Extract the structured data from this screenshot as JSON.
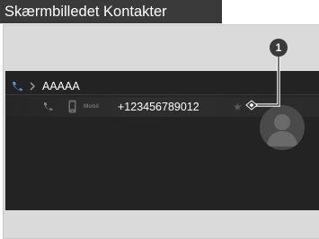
{
  "caption": {
    "title": "Skærmbilledet Kontakter"
  },
  "contact": {
    "name": "AAAAA"
  },
  "entry": {
    "type_label": "Mobil",
    "number": "+123456789012"
  },
  "callout": {
    "number": "1"
  },
  "icons": {
    "phone": "phone-icon",
    "chevron": "chevron-right-icon",
    "mobile": "mobile-phone-icon",
    "star": "star-icon",
    "avatar": "person-avatar-icon"
  },
  "colors": {
    "caption_bg": "#3a3a3a",
    "frame_bg": "#dadada",
    "screen_bg": "#232323",
    "accent_blue": "#4f8fd9"
  }
}
